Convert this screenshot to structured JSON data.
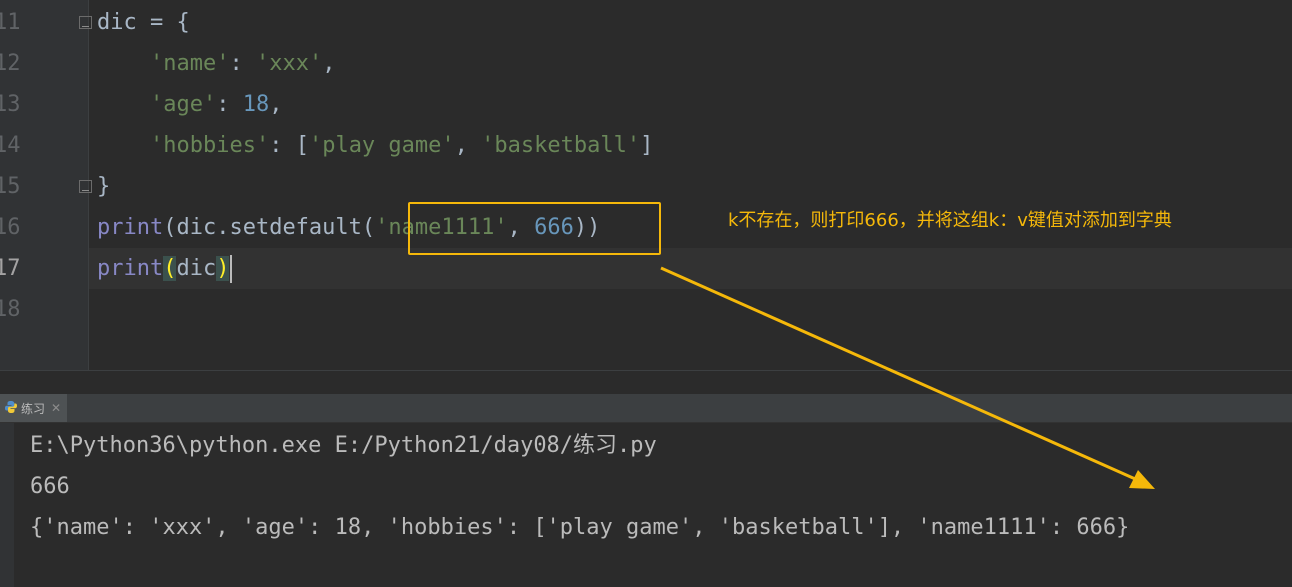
{
  "editor": {
    "line_numbers": [
      "11",
      "12",
      "13",
      "14",
      "15",
      "16",
      "17",
      "18"
    ],
    "current_line": "17",
    "lines": {
      "l11": {
        "name": "dic",
        "op": " = {"
      },
      "l12": {
        "key": "'name'",
        "colon": ": ",
        "val": "'xxx'",
        "end": ","
      },
      "l13": {
        "key": "'age'",
        "colon": ": ",
        "val": "18",
        "end": ","
      },
      "l14": {
        "key": "'hobbies'",
        "colon": ": [",
        "v1": "'play game'",
        "sep": ", ",
        "v2": "'basketball'",
        "end": "]"
      },
      "l15": {
        "close": "}"
      },
      "l16": {
        "fn": "print",
        "open": "(dic.setdefault(",
        "arg1": "'name1111'",
        "sep": ", ",
        "arg2": "666",
        "close": "))"
      },
      "l17": {
        "fn": "print",
        "open": "(",
        "arg": "dic",
        "close": ")"
      }
    }
  },
  "annotation": {
    "text": "k不存在，则打印666，并将这组k：v键值对添加到字典",
    "color": "#f5b80a"
  },
  "run_panel": {
    "tab_label": "练习",
    "tab_icon": "python-icon",
    "close_icon": "close-icon"
  },
  "console": {
    "lines": [
      "E:\\Python36\\python.exe E:/Python21/day08/练习.py",
      "666",
      "{'name': 'xxx', 'age': 18, 'hobbies': ['play game', 'basketball'], 'name1111': 666}"
    ]
  },
  "colors": {
    "background": "#2b2b2b",
    "string": "#6a8759",
    "number": "#6897bb",
    "builtin": "#8888c6",
    "default_text": "#a9b7c6",
    "accent": "#f5b80a"
  }
}
